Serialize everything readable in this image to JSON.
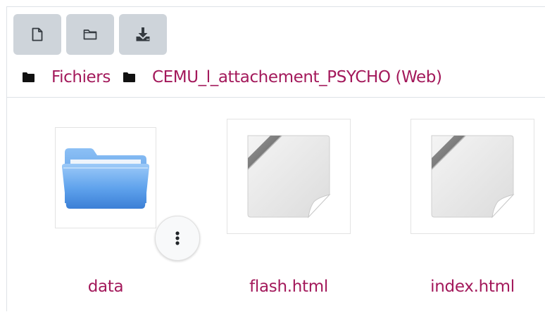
{
  "toolbar": {
    "buttons": [
      {
        "icon": "new-file-icon"
      },
      {
        "icon": "new-folder-icon"
      },
      {
        "icon": "download-icon"
      }
    ]
  },
  "breadcrumb": {
    "items": [
      {
        "label": "Fichiers",
        "icon": "folder-icon"
      },
      {
        "label": "CEMU_l_attachement_PSYCHO (Web)",
        "icon": "folder-icon"
      }
    ]
  },
  "files": [
    {
      "name": "data",
      "type": "folder",
      "icon": "folder-icon",
      "has_menu": true,
      "menu_icon": "kebab-menu-icon"
    },
    {
      "name": "flash.html",
      "type": "file",
      "icon": "generic-file-icon"
    },
    {
      "name": "index.html",
      "type": "file",
      "icon": "generic-file-icon"
    }
  ],
  "colors": {
    "link": "#a3195b",
    "toolbar_button": "#ced4da",
    "toolbar_icon": "#343a40",
    "folder_blue": "#5b9ee9",
    "border": "#dee2e6"
  }
}
